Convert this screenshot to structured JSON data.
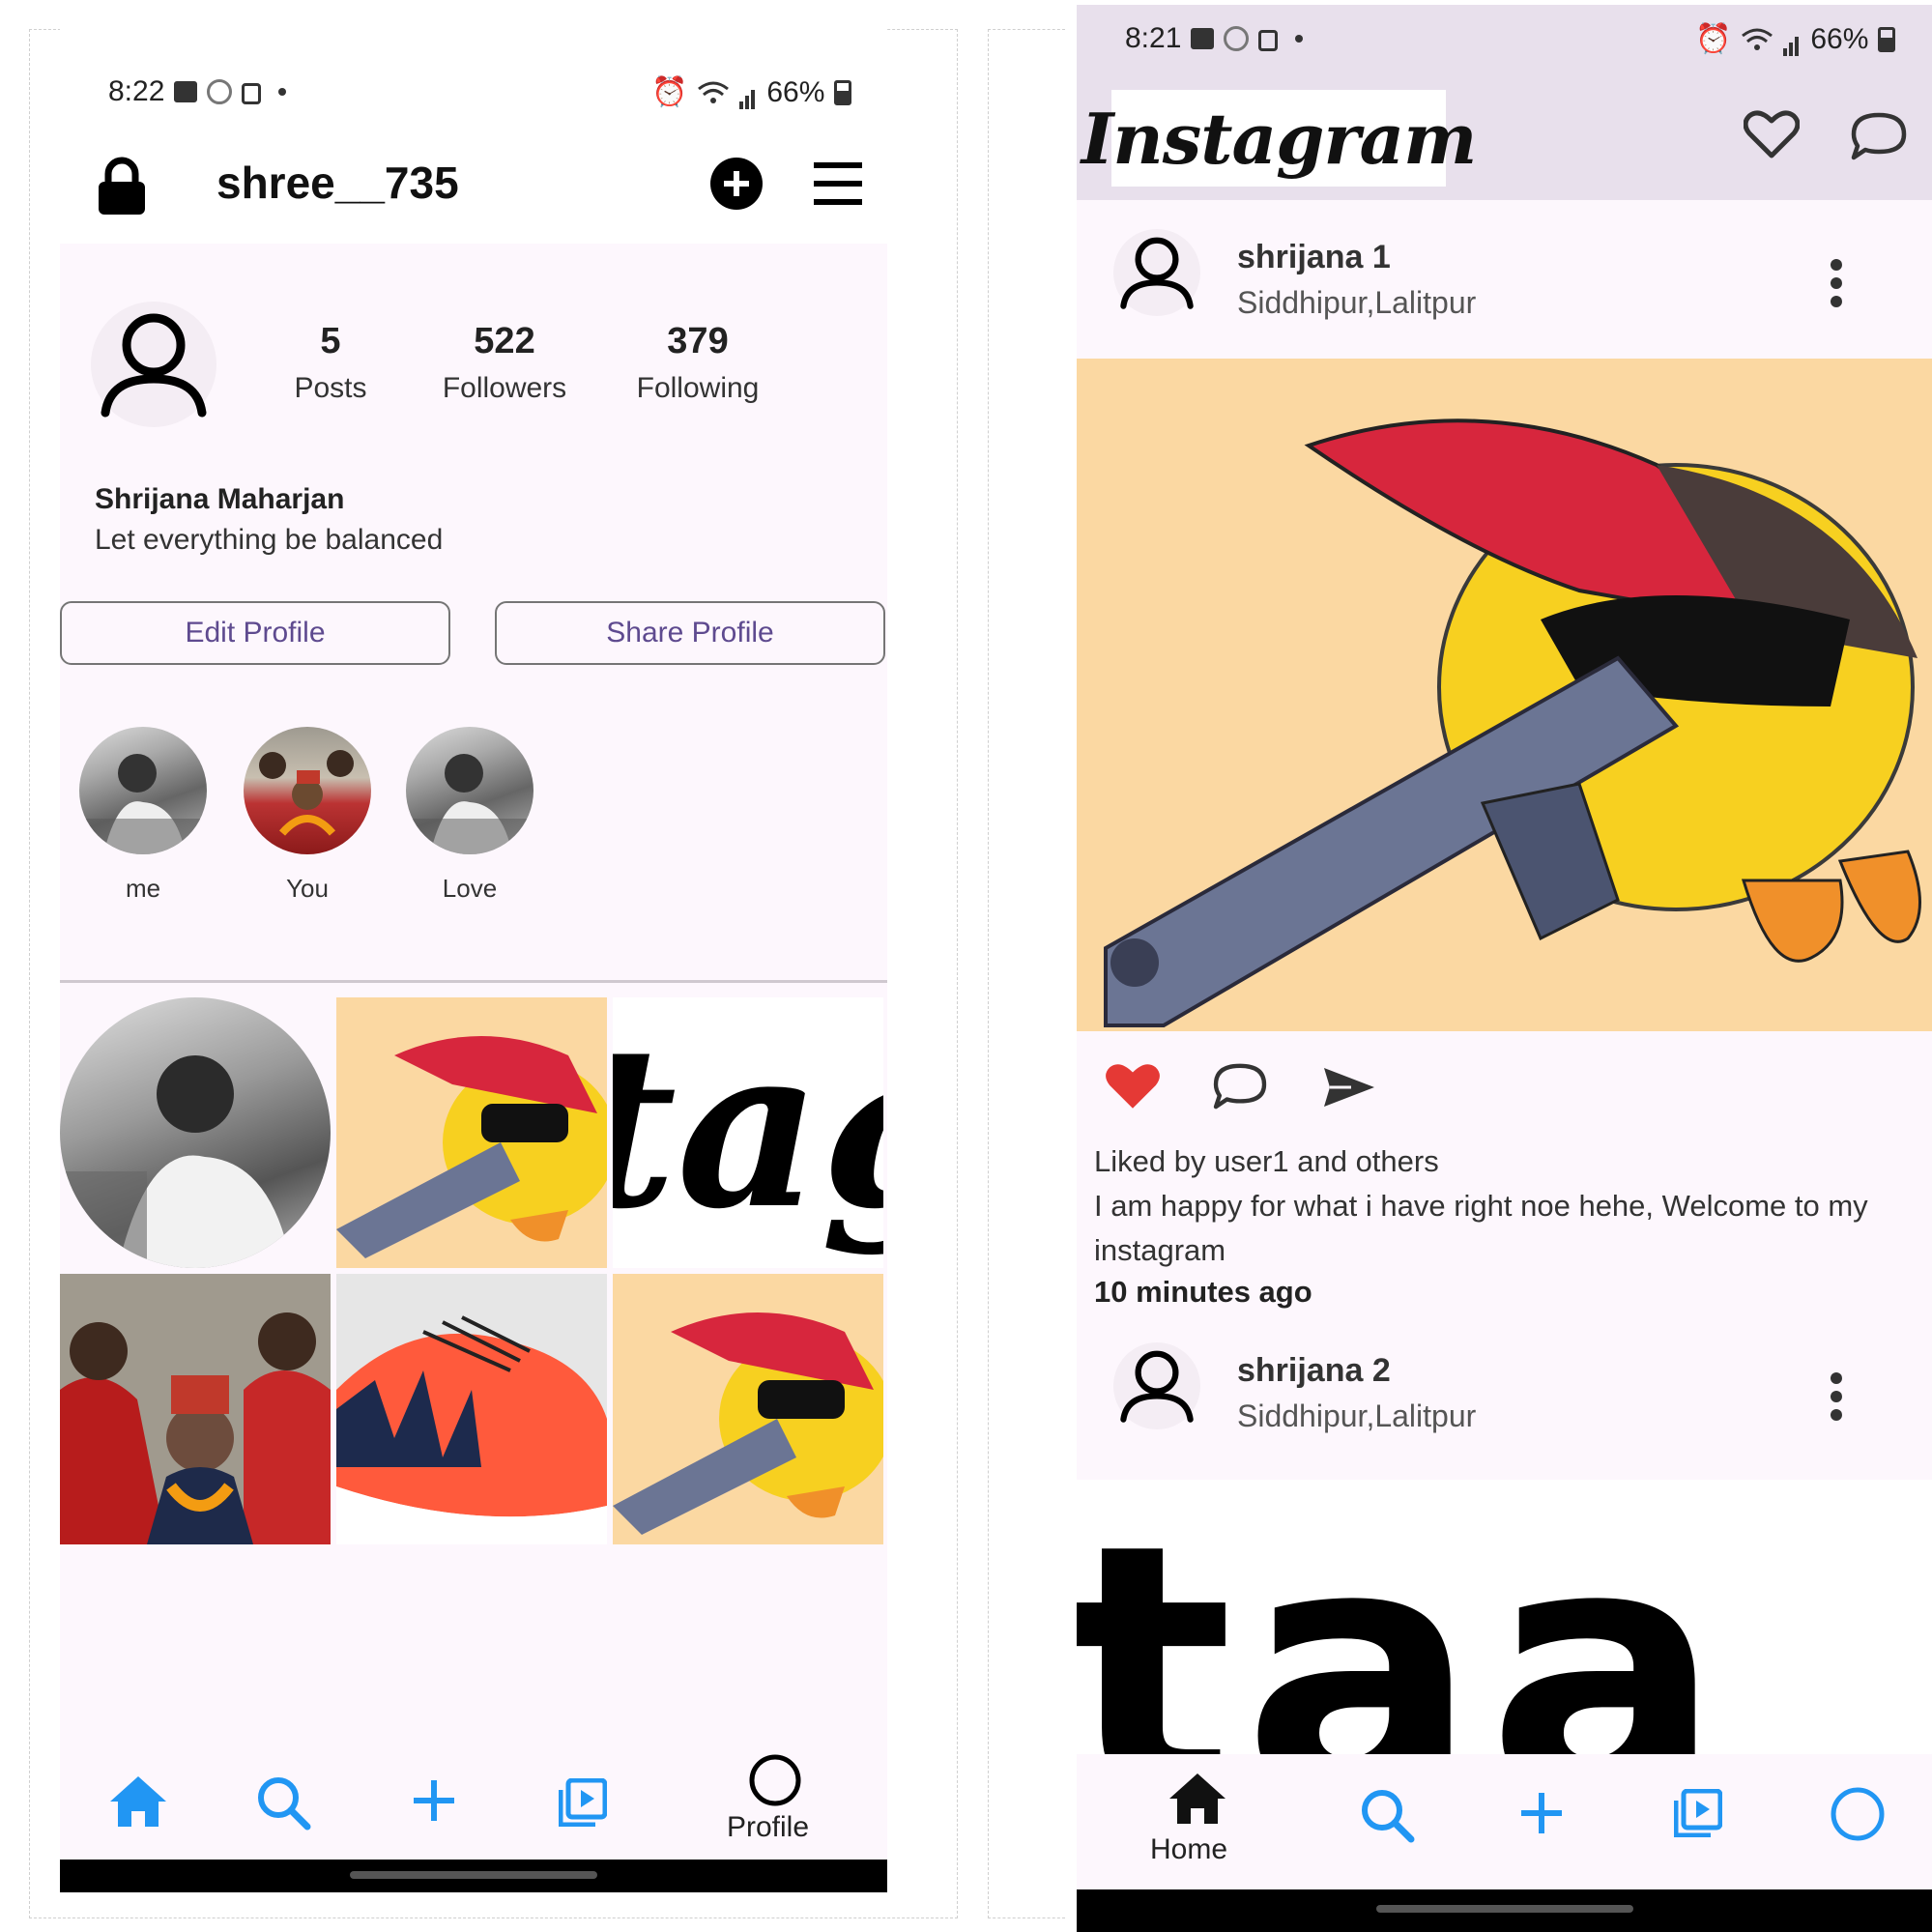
{
  "left_screen": {
    "status_bar": {
      "time": "8:22",
      "battery": "66%"
    },
    "header": {
      "username": "shree__735"
    },
    "profile": {
      "stats": [
        {
          "value": "5",
          "label": "Posts"
        },
        {
          "value": "522",
          "label": "Followers"
        },
        {
          "value": "379",
          "label": "Following"
        }
      ],
      "display_name": "Shrijana Maharjan",
      "bio": "Let everything be balanced",
      "edit_button": "Edit Profile",
      "share_button": "Share Profile"
    },
    "highlights": [
      {
        "label": "me"
      },
      {
        "label": "You"
      },
      {
        "label": "Love"
      }
    ],
    "grid_text_fragment": "tag",
    "bottom_nav": {
      "profile_label": "Profile"
    }
  },
  "right_screen": {
    "status_bar": {
      "time": "8:21",
      "battery": "66%"
    },
    "app_title": "Instagram",
    "posts": [
      {
        "username": "shrijana 1",
        "location": "Siddhipur,Lalitpur",
        "likes_text": "Liked by user1 and others",
        "caption": "I am happy for what i have right noe hehe, Welcome to my instagram",
        "time_ago": "10  minutes ago"
      },
      {
        "username": "shrijana 2",
        "location": "Siddhipur,Lalitpur",
        "image_text_fragment": "taa"
      }
    ],
    "bottom_nav": {
      "home_label": "Home"
    }
  },
  "colors": {
    "accent_blue": "#2196f3",
    "button_text": "#5e4a8f",
    "panel_bg": "#fdf7fd",
    "topbar_bg": "#e8e0ec",
    "post_bg": "#fbd8a2",
    "like_red": "#e53935"
  }
}
